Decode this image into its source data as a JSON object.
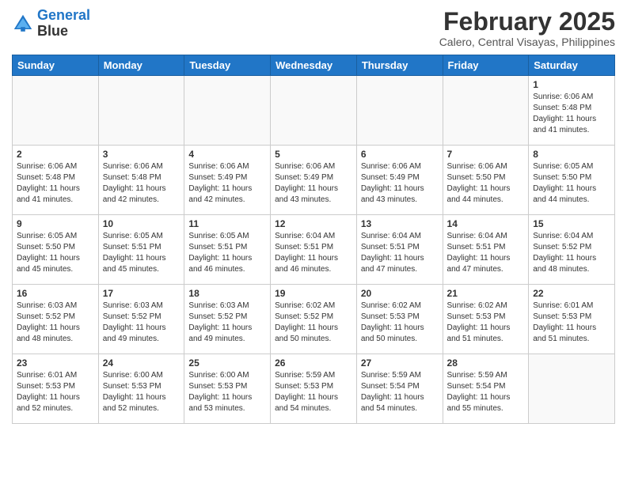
{
  "header": {
    "logo_line1": "General",
    "logo_line2": "Blue",
    "month_title": "February 2025",
    "location": "Calero, Central Visayas, Philippines"
  },
  "weekdays": [
    "Sunday",
    "Monday",
    "Tuesday",
    "Wednesday",
    "Thursday",
    "Friday",
    "Saturday"
  ],
  "weeks": [
    [
      {
        "day": "",
        "info": ""
      },
      {
        "day": "",
        "info": ""
      },
      {
        "day": "",
        "info": ""
      },
      {
        "day": "",
        "info": ""
      },
      {
        "day": "",
        "info": ""
      },
      {
        "day": "",
        "info": ""
      },
      {
        "day": "1",
        "info": "Sunrise: 6:06 AM\nSunset: 5:48 PM\nDaylight: 11 hours and 41 minutes."
      }
    ],
    [
      {
        "day": "2",
        "info": "Sunrise: 6:06 AM\nSunset: 5:48 PM\nDaylight: 11 hours and 41 minutes."
      },
      {
        "day": "3",
        "info": "Sunrise: 6:06 AM\nSunset: 5:48 PM\nDaylight: 11 hours and 42 minutes."
      },
      {
        "day": "4",
        "info": "Sunrise: 6:06 AM\nSunset: 5:49 PM\nDaylight: 11 hours and 42 minutes."
      },
      {
        "day": "5",
        "info": "Sunrise: 6:06 AM\nSunset: 5:49 PM\nDaylight: 11 hours and 43 minutes."
      },
      {
        "day": "6",
        "info": "Sunrise: 6:06 AM\nSunset: 5:49 PM\nDaylight: 11 hours and 43 minutes."
      },
      {
        "day": "7",
        "info": "Sunrise: 6:06 AM\nSunset: 5:50 PM\nDaylight: 11 hours and 44 minutes."
      },
      {
        "day": "8",
        "info": "Sunrise: 6:05 AM\nSunset: 5:50 PM\nDaylight: 11 hours and 44 minutes."
      }
    ],
    [
      {
        "day": "9",
        "info": "Sunrise: 6:05 AM\nSunset: 5:50 PM\nDaylight: 11 hours and 45 minutes."
      },
      {
        "day": "10",
        "info": "Sunrise: 6:05 AM\nSunset: 5:51 PM\nDaylight: 11 hours and 45 minutes."
      },
      {
        "day": "11",
        "info": "Sunrise: 6:05 AM\nSunset: 5:51 PM\nDaylight: 11 hours and 46 minutes."
      },
      {
        "day": "12",
        "info": "Sunrise: 6:04 AM\nSunset: 5:51 PM\nDaylight: 11 hours and 46 minutes."
      },
      {
        "day": "13",
        "info": "Sunrise: 6:04 AM\nSunset: 5:51 PM\nDaylight: 11 hours and 47 minutes."
      },
      {
        "day": "14",
        "info": "Sunrise: 6:04 AM\nSunset: 5:51 PM\nDaylight: 11 hours and 47 minutes."
      },
      {
        "day": "15",
        "info": "Sunrise: 6:04 AM\nSunset: 5:52 PM\nDaylight: 11 hours and 48 minutes."
      }
    ],
    [
      {
        "day": "16",
        "info": "Sunrise: 6:03 AM\nSunset: 5:52 PM\nDaylight: 11 hours and 48 minutes."
      },
      {
        "day": "17",
        "info": "Sunrise: 6:03 AM\nSunset: 5:52 PM\nDaylight: 11 hours and 49 minutes."
      },
      {
        "day": "18",
        "info": "Sunrise: 6:03 AM\nSunset: 5:52 PM\nDaylight: 11 hours and 49 minutes."
      },
      {
        "day": "19",
        "info": "Sunrise: 6:02 AM\nSunset: 5:52 PM\nDaylight: 11 hours and 50 minutes."
      },
      {
        "day": "20",
        "info": "Sunrise: 6:02 AM\nSunset: 5:53 PM\nDaylight: 11 hours and 50 minutes."
      },
      {
        "day": "21",
        "info": "Sunrise: 6:02 AM\nSunset: 5:53 PM\nDaylight: 11 hours and 51 minutes."
      },
      {
        "day": "22",
        "info": "Sunrise: 6:01 AM\nSunset: 5:53 PM\nDaylight: 11 hours and 51 minutes."
      }
    ],
    [
      {
        "day": "23",
        "info": "Sunrise: 6:01 AM\nSunset: 5:53 PM\nDaylight: 11 hours and 52 minutes."
      },
      {
        "day": "24",
        "info": "Sunrise: 6:00 AM\nSunset: 5:53 PM\nDaylight: 11 hours and 52 minutes."
      },
      {
        "day": "25",
        "info": "Sunrise: 6:00 AM\nSunset: 5:53 PM\nDaylight: 11 hours and 53 minutes."
      },
      {
        "day": "26",
        "info": "Sunrise: 5:59 AM\nSunset: 5:53 PM\nDaylight: 11 hours and 54 minutes."
      },
      {
        "day": "27",
        "info": "Sunrise: 5:59 AM\nSunset: 5:54 PM\nDaylight: 11 hours and 54 minutes."
      },
      {
        "day": "28",
        "info": "Sunrise: 5:59 AM\nSunset: 5:54 PM\nDaylight: 11 hours and 55 minutes."
      },
      {
        "day": "",
        "info": ""
      }
    ]
  ]
}
